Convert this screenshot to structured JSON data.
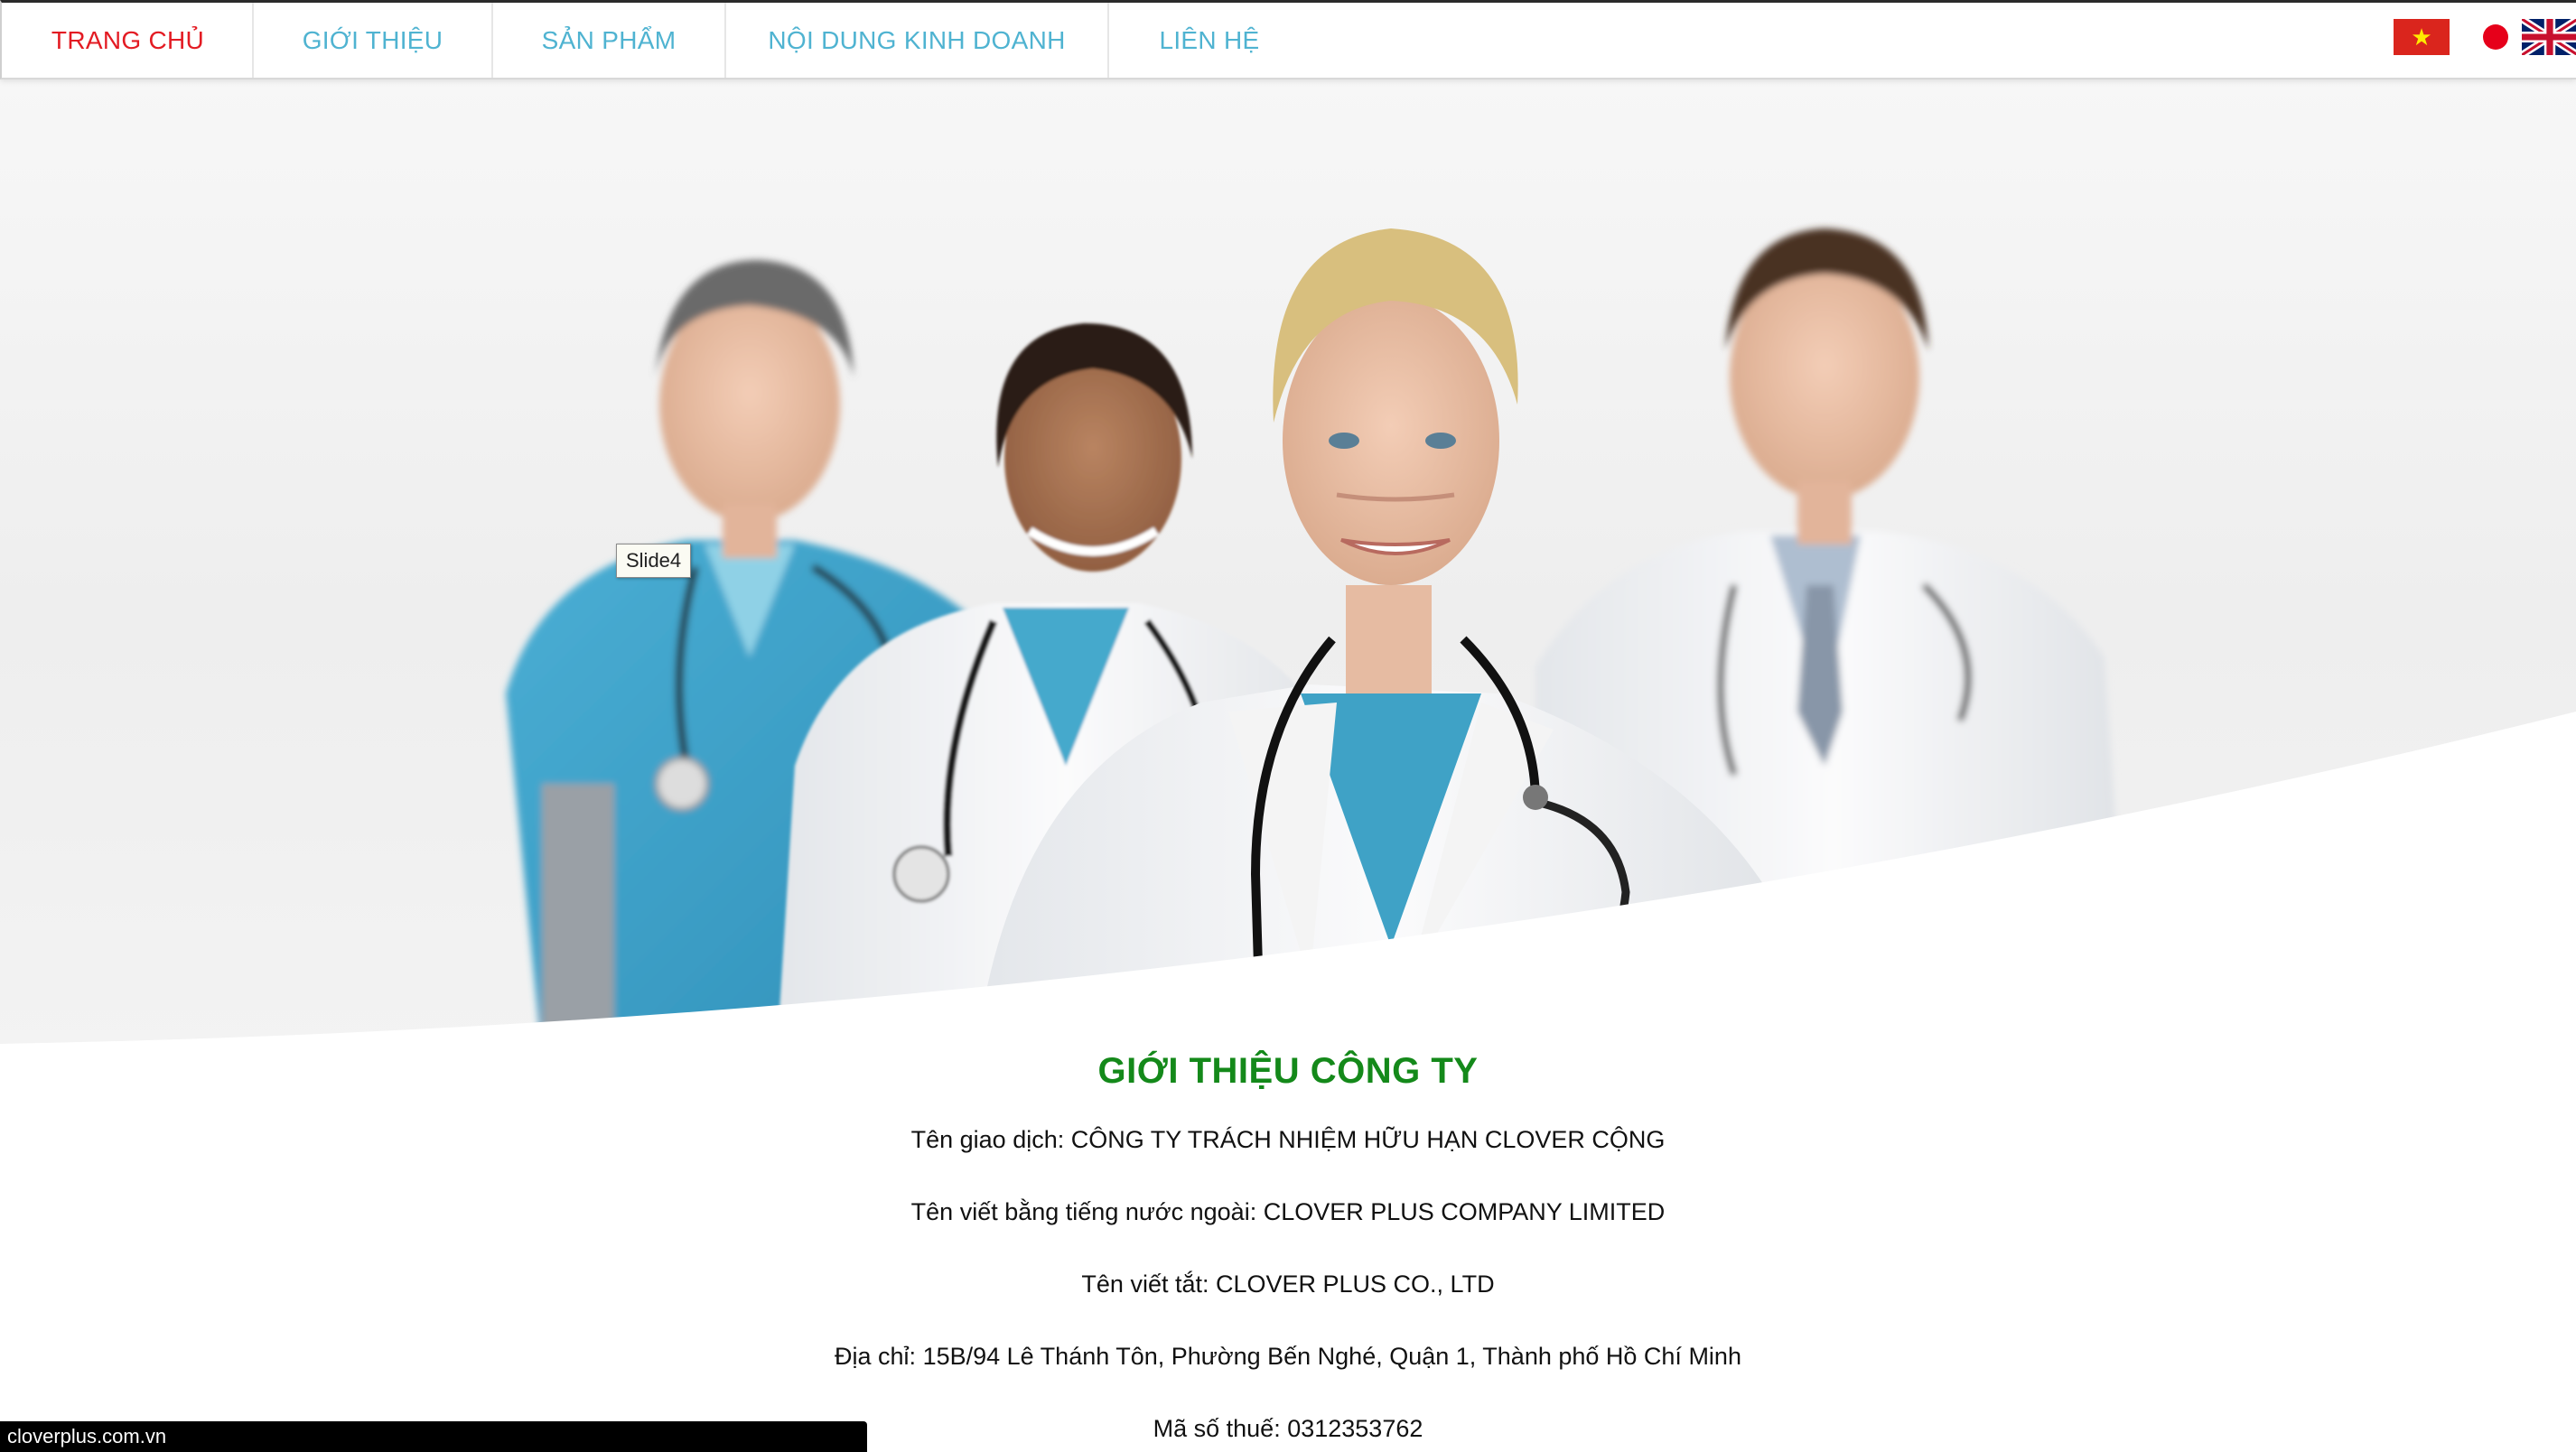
{
  "nav": {
    "items": [
      {
        "label": "TRANG CHỦ",
        "active": true
      },
      {
        "label": "GIỚI THIỆU",
        "active": false
      },
      {
        "label": "SẢN PHẨM",
        "active": false
      },
      {
        "label": "NỘI DUNG KINH DOANH",
        "active": false
      },
      {
        "label": "LIÊN HỆ",
        "active": false
      }
    ],
    "languages": [
      "vietnam-flag-icon",
      "japan-flag-icon",
      "uk-flag-icon"
    ]
  },
  "hero": {
    "tooltip": "Slide4"
  },
  "intro": {
    "title": "GIỚI THIỆU CÔNG TY",
    "lines": [
      "Tên giao dịch: CÔNG TY TRÁCH NHIỆM HỮU HẠN CLOVER CỘNG",
      "Tên viết bằng tiếng nước ngoài: CLOVER PLUS COMPANY LIMITED",
      "Tên viết tắt: CLOVER PLUS CO., LTD",
      "Địa chỉ: 15B/94 Lê Thánh Tôn, Phường Bến Nghé, Quận 1, Thành phố Hồ Chí Minh",
      "Mã số thuế:  0312353762"
    ]
  },
  "status_bar": {
    "url": "cloverplus.com.vn"
  },
  "colors": {
    "nav_link": "#4fb3d1",
    "nav_active": "#e31b23",
    "title_green": "#14891a"
  }
}
